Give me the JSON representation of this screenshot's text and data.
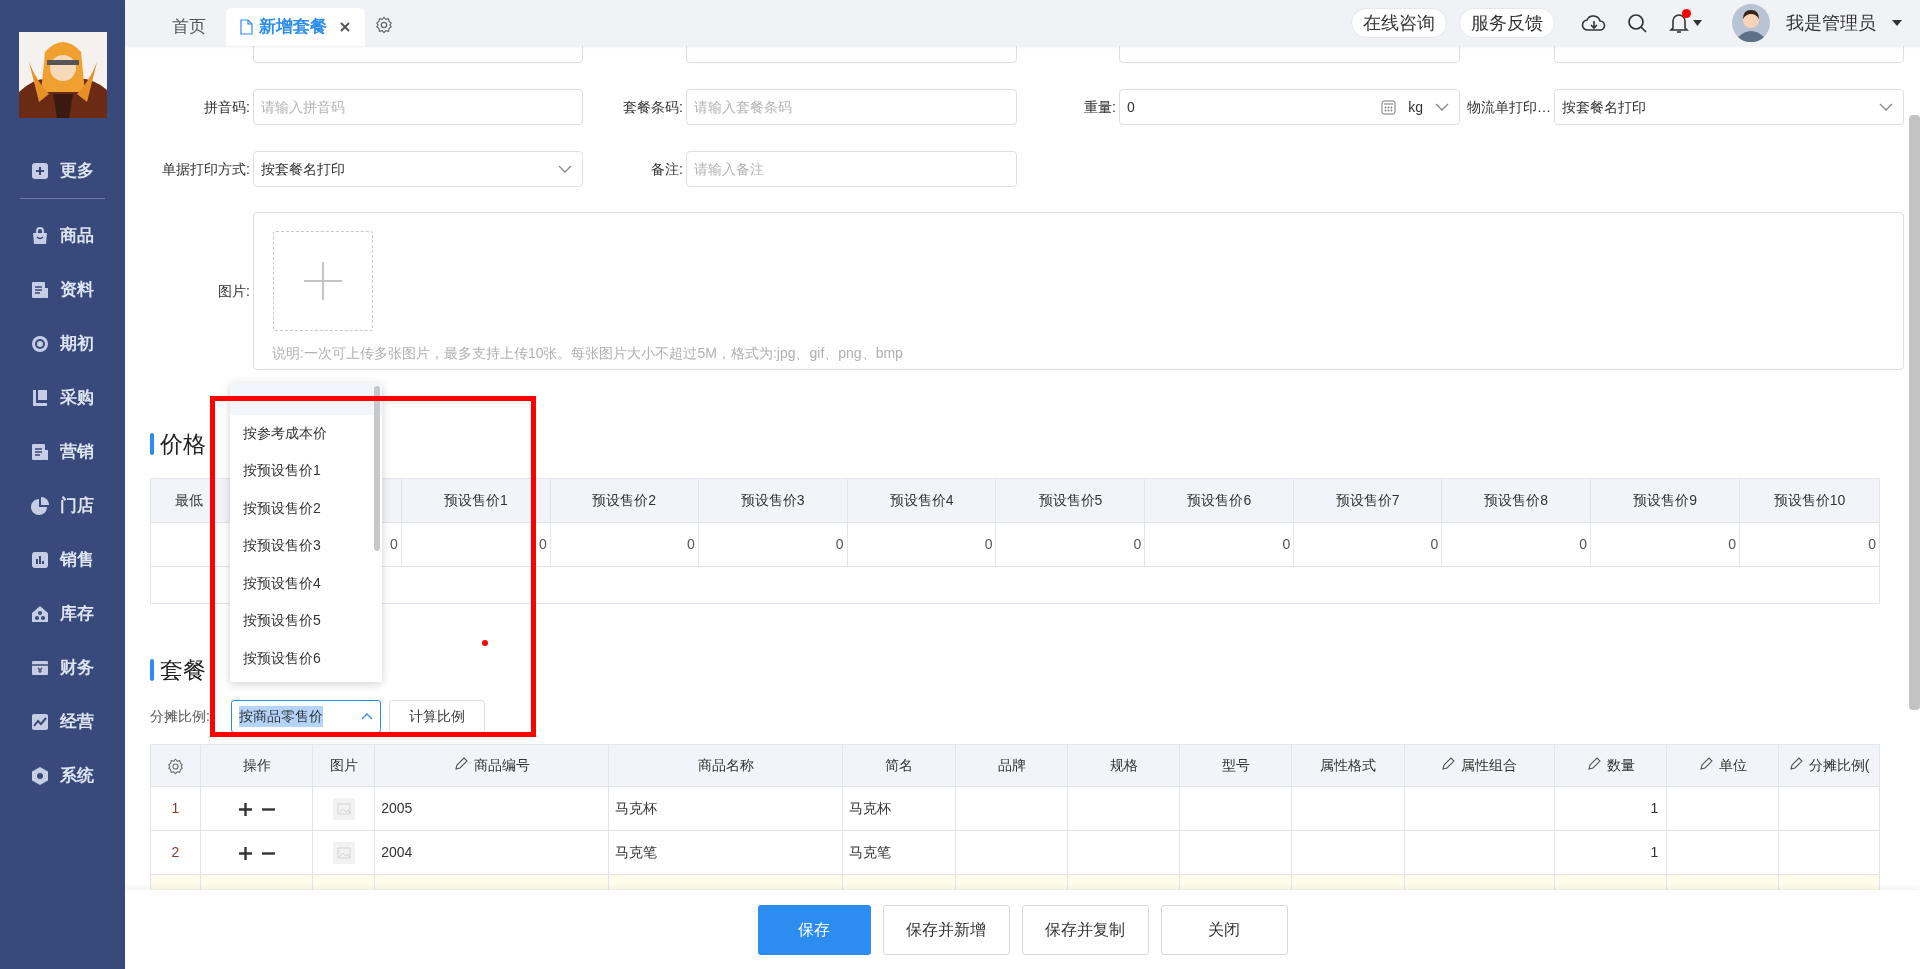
{
  "sidebar": {
    "items": [
      {
        "label": "更多"
      },
      {
        "label": "商品"
      },
      {
        "label": "资料"
      },
      {
        "label": "期初"
      },
      {
        "label": "采购"
      },
      {
        "label": "营销"
      },
      {
        "label": "门店"
      },
      {
        "label": "销售"
      },
      {
        "label": "库存"
      },
      {
        "label": "财务"
      },
      {
        "label": "经营"
      },
      {
        "label": "系统"
      }
    ]
  },
  "header": {
    "tabs": [
      {
        "label": "首页",
        "selected": false
      },
      {
        "label": "新增套餐",
        "selected": true
      }
    ],
    "links": [
      "在线咨询",
      "服务反馈"
    ],
    "notification_dot": true,
    "user": "我是管理员"
  },
  "form": {
    "rows": [
      [
        {
          "label": "拼音码:",
          "kind": "text",
          "placeholder": "请输入拼音码"
        },
        {
          "label": "套餐条码:",
          "kind": "text",
          "placeholder": "请输入套餐条码"
        },
        {
          "label": "重量:",
          "kind": "unit",
          "value": "0",
          "unit": "kg"
        },
        {
          "label": "物流单打印…",
          "kind": "select",
          "value": "按套餐名打印"
        }
      ],
      [
        {
          "label": "单据打印方式:",
          "kind": "select",
          "value": "按套餐名打印"
        },
        {
          "label": "备注:",
          "kind": "text",
          "placeholder": "请输入备注"
        }
      ]
    ],
    "image": {
      "label": "图片:",
      "note": "说明:一次可上传多张图片，最多支持上传10张。每张图片大小不超过5M，格式为:jpg、gif、png、bmp"
    }
  },
  "price": {
    "title": "价格",
    "columns": [
      {
        "header": "最低"
      },
      {
        "value": "0"
      },
      {
        "header": "预设售价1",
        "value": "0"
      },
      {
        "header": "预设售价2",
        "value": "0"
      },
      {
        "header": "预设售价3",
        "value": "0"
      },
      {
        "header": "预设售价4",
        "value": "0"
      },
      {
        "header": "预设售价5",
        "value": "0"
      },
      {
        "header": "预设售价6",
        "value": "0"
      },
      {
        "header": "预设售价7",
        "value": "0"
      },
      {
        "header": "预设售价8",
        "value": "0"
      },
      {
        "header": "预设售价9",
        "value": "0"
      },
      {
        "header": "预设售价10",
        "value": "0"
      }
    ]
  },
  "detail": {
    "title": "套餐",
    "allocation": {
      "label": "分摊比例:",
      "value": "按商品零售价",
      "open": true,
      "button": "计算比例",
      "options": [
        {
          "selected": true
        },
        {
          "label": "按参考成本价",
          "selected": false
        },
        {
          "label": "按预设售价1",
          "selected": false
        },
        {
          "label": "按预设售价2",
          "selected": false
        },
        {
          "label": "按预设售价3",
          "selected": false
        },
        {
          "label": "按预设售价4",
          "selected": false
        },
        {
          "label": "按预设售价5",
          "selected": false
        },
        {
          "label": "按预设售价6",
          "selected": false
        }
      ]
    },
    "columns": [
      {
        "kind": "settings"
      },
      {
        "label": "操作",
        "editable": false
      },
      {
        "label": "图片",
        "editable": false
      },
      {
        "label": "商品编号",
        "editable": true
      },
      {
        "label": "商品名称",
        "editable": false
      },
      {
        "label": "简名",
        "editable": false
      },
      {
        "label": "品牌",
        "editable": false
      },
      {
        "label": "规格",
        "editable": false
      },
      {
        "label": "型号",
        "editable": false
      },
      {
        "label": "属性格式",
        "editable": false
      },
      {
        "label": "属性组合",
        "editable": true
      },
      {
        "label": "数量",
        "editable": true
      },
      {
        "label": "单位",
        "editable": true
      },
      {
        "label": "分摊比例(",
        "editable": true
      }
    ],
    "rows": [
      {
        "number": "1",
        "code": "2005",
        "name": "马克杯",
        "short_name": "马克杯",
        "quantity": "1"
      },
      {
        "number": "2",
        "code": "2004",
        "name": "马克笔",
        "short_name": "马克笔",
        "quantity": "1"
      }
    ]
  },
  "footer": {
    "buttons": [
      {
        "label": "保存",
        "primary": true
      },
      {
        "label": "保存并新增",
        "primary": false
      },
      {
        "label": "保存并复制",
        "primary": false
      },
      {
        "label": "关闭",
        "primary": false
      }
    ]
  }
}
